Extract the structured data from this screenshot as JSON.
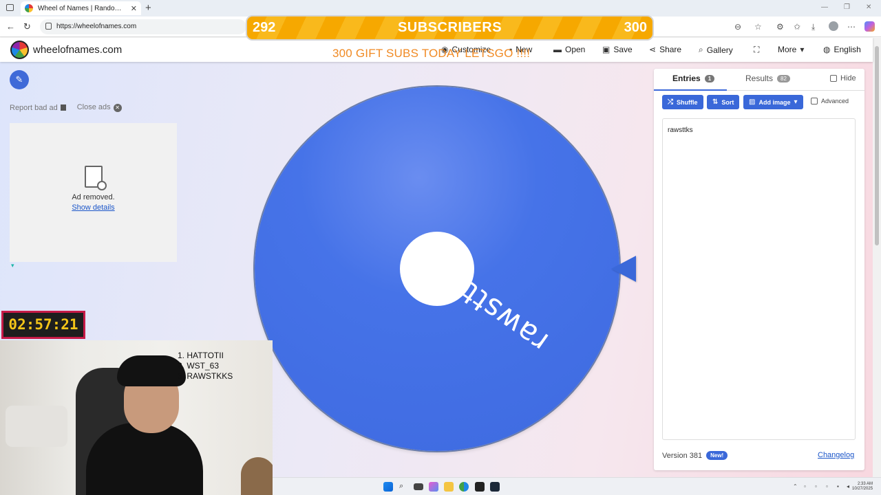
{
  "browser": {
    "tab_title": "Wheel of Names | Random name",
    "url": "https://wheelofnames.com"
  },
  "overlay": {
    "subs_current": "292",
    "subs_label": "SUBSCRIBERS",
    "subs_goal": "300",
    "gift_text": "300 GIFT SUBS TODAY LETSGO !!!!",
    "timer": "02:57:21",
    "list": [
      "1.  HATTOTII",
      "2.  WST_63",
      "3.  RAWSTKKS"
    ]
  },
  "site": {
    "brand": "wheelofnames.com",
    "menu": {
      "customize": "Customize",
      "new": "New",
      "open": "Open",
      "save": "Save",
      "share": "Share",
      "gallery": "Gallery",
      "more": "More",
      "language": "English"
    }
  },
  "ad": {
    "report": "Report bad ad",
    "close": "Close ads",
    "removed": "Ad removed.",
    "details": "Show details"
  },
  "wheel": {
    "entry_label": "rawsttks",
    "color": "#4673e8"
  },
  "panel": {
    "entries_label": "Entries",
    "entries_count": "1",
    "results_label": "Results",
    "results_count": "82",
    "hide_label": "Hide",
    "shuffle": "Shuffle",
    "sort": "Sort",
    "add_image": "Add image",
    "advanced": "Advanced",
    "entries_text": "rawsttks",
    "version": "Version 381",
    "new_badge": "New!",
    "changelog": "Changelog"
  },
  "taskbar": {
    "time": "2:33 AM",
    "date": "10/27/2025"
  }
}
